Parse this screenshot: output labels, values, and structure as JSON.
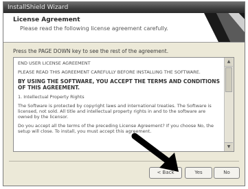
{
  "window": {
    "title": "InstallShield Wizard"
  },
  "header": {
    "title": "License Agreement",
    "subtitle": "Please read the following license agreement carefully."
  },
  "instruction": "Press the PAGE DOWN key to see the rest of the agreement.",
  "license": {
    "paragraphs": [
      "END USER LICENSE AGREEMENT",
      "PLEASE READ THIS AGREEMENT CAREFULLY BEFORE INSTALLING THE SOFTWARE.",
      "BY USING THE SOFTWARE, YOU ACCEPT THE TERMS AND CONDITIONS OF THIS AGREEMENT.",
      "1. Intellectual Property Rights",
      "The Software is protected by copyright laws and international treaties. The Software is licensed, not sold. All title and intellectual property rights in and to the software are owned by the licensor."
    ]
  },
  "question": "Do you accept all the terms of the preceding License Agreement? If you choose No, the setup will close. To install, you must accept this agreement.",
  "buttons": {
    "back": "< Back",
    "yes": "Yes",
    "no": "No"
  },
  "colors": {
    "dialog_background": "#ece9d8",
    "arrow": "#000000"
  }
}
